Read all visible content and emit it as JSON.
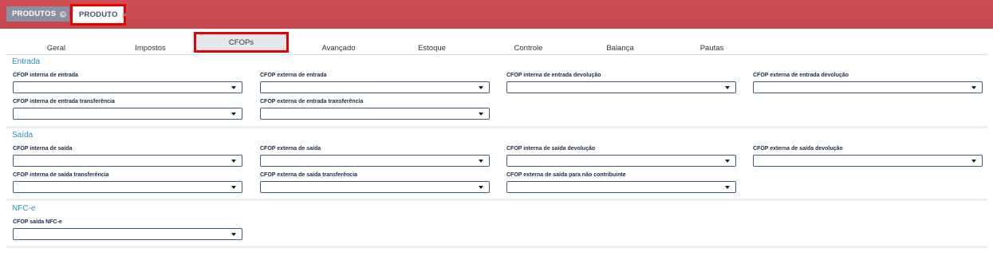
{
  "top_tabs": [
    {
      "label": "PRODUTOS"
    },
    {
      "label": "PRODUTO"
    }
  ],
  "tabs": [
    "Geral",
    "Impostos",
    "CFOPs",
    "Avançado",
    "Estoque",
    "Controle",
    "Balança",
    "Pautas"
  ],
  "active_tab": "CFOPs",
  "sections": {
    "entrada": {
      "title": "Entrada",
      "fields": [
        "CFOP interna de entrada",
        "CFOP externa de entrada",
        "CFOP interna de entrada devolução",
        "CFOP externa de entrada devolução",
        "CFOP interna de entrada transferência",
        "CFOP externa de entrada transferência"
      ]
    },
    "saida": {
      "title": "Saída",
      "fields": [
        "CFOP interna de saída",
        "CFOP externa de saída",
        "CFOP interna de saída devolução",
        "CFOP externa de saída devolução",
        "CFOP interna de saída transferência",
        "CFOP externa de saída transferência",
        "CFOP externa de saída para não contribuinte"
      ]
    },
    "nfce": {
      "title": "NFC-e",
      "fields": [
        "CFOP saída NFC-e"
      ]
    }
  },
  "colors": {
    "header": "#c94a51",
    "accent": "#2a8fc8",
    "highlight": "#e60000"
  },
  "icons": [
    "close-icon",
    "chevron-down-icon"
  ]
}
